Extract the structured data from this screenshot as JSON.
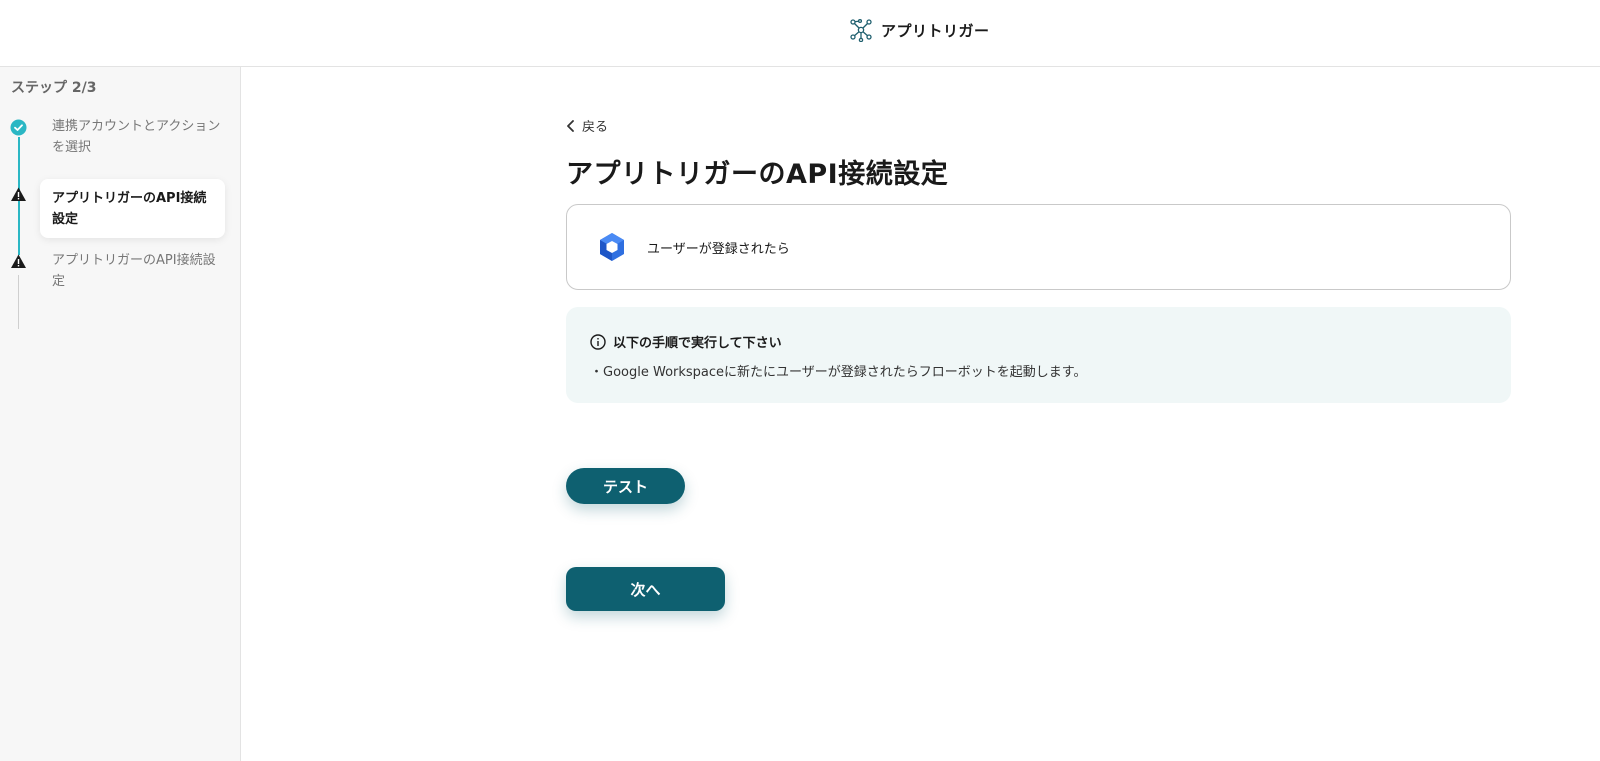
{
  "header": {
    "app_name": "アプリトリガー",
    "logo_icon": "network-nodes-icon"
  },
  "sidebar": {
    "step_title": "ステップ 2/3",
    "steps": [
      {
        "label": "連携アカウントとアクションを選択",
        "status": "completed",
        "icon": "check-circle-icon"
      },
      {
        "label": "アプリトリガーのAPI接続設定",
        "status": "warning-active",
        "icon": "warning-icon"
      },
      {
        "label": "アプリトリガーのAPI接続設定",
        "status": "warning",
        "icon": "warning-icon"
      }
    ]
  },
  "main": {
    "back_label": "戻る",
    "title": "アプリトリガーのAPI接続設定",
    "trigger": {
      "app_icon": "google-workspace-icon",
      "label": "ユーザーが登録されたら"
    },
    "info": {
      "heading": "以下の手順で実行して下さい",
      "body": "・Google Workspaceに新たにユーザーが登録されたらフローボットを起動します。"
    },
    "test_button": "テスト",
    "next_button": "次へ"
  },
  "colors": {
    "primary": "#0e6070",
    "accent_teal": "#2bb7c4",
    "info_bg": "#f0f7f7",
    "sidebar_bg": "#f7f7f7"
  }
}
